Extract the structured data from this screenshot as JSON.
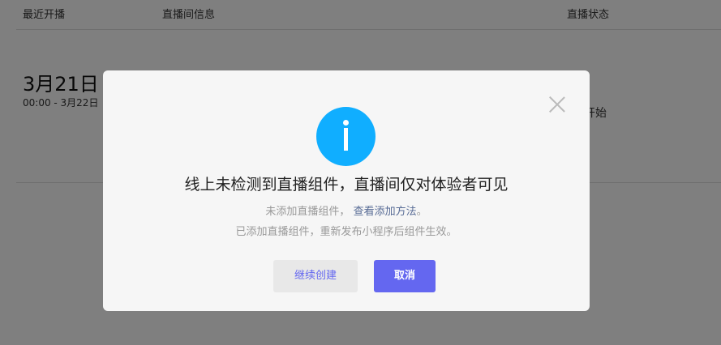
{
  "table": {
    "headers": [
      "最近开播",
      "直播间信息",
      "直播状态"
    ],
    "row": {
      "date": "3月21日",
      "time_range": "00:00 - 3月22日",
      "status": "开始"
    }
  },
  "dialog": {
    "icon": "info-icon",
    "title": "线上未检测到直播组件，直播间仅对体验者可见",
    "line1_prefix": "未添加直播组件，",
    "line1_link": "查看添加方法",
    "line1_suffix": "。",
    "line2": "已添加直播组件，重新发布小程序后组件生效。",
    "continue_label": "继续创建",
    "cancel_label": "取消",
    "colors": {
      "accent": "#6467f0",
      "info": "#10aeff",
      "link": "#576b95"
    }
  }
}
